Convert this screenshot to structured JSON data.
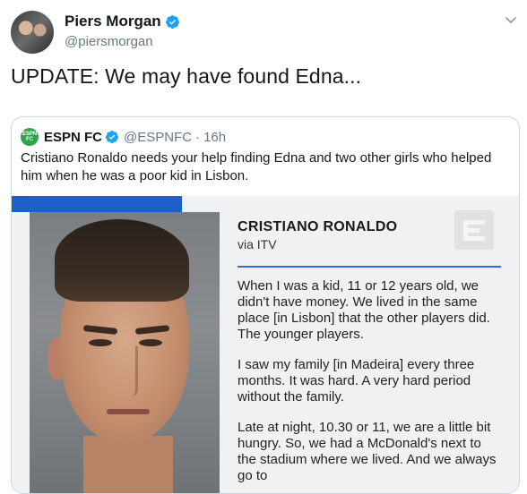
{
  "author": {
    "name": "Piers Morgan",
    "handle": "@piersmorgan",
    "verified_icon": "verified-badge-icon",
    "avatar": "avatar-photo"
  },
  "tweet": {
    "text": "UPDATE: We may have found Edna..."
  },
  "quoted": {
    "logo_text": "ESPN FC",
    "name": "ESPN FC",
    "handle": "@ESPNFC",
    "dot": "·",
    "time": "16h",
    "text": "Cristiano Ronaldo needs your help finding Edna and two other girls who helped him when he was a poor kid in Lisbon.",
    "card": {
      "title": "CRISTIANO RONALDO",
      "subtitle": "via ITV",
      "paragraphs": [
        "When I was a kid, 11 or 12 years old, we didn't have money. We lived in the same place [in Lisbon] that the other players did. The younger players.",
        "I saw my family [in Madeira] every three months. It was hard. A very hard period without the family.",
        "Late at night, 10.30 or 11, we are a little bit hungry. So, we had a McDonald's next to the stadium where we lived. And we always go to"
      ]
    }
  },
  "colors": {
    "verified": "#1da1f2",
    "accent_blue": "#1f60c8",
    "muted": "#657786",
    "espn_green": "#2fa44f"
  }
}
